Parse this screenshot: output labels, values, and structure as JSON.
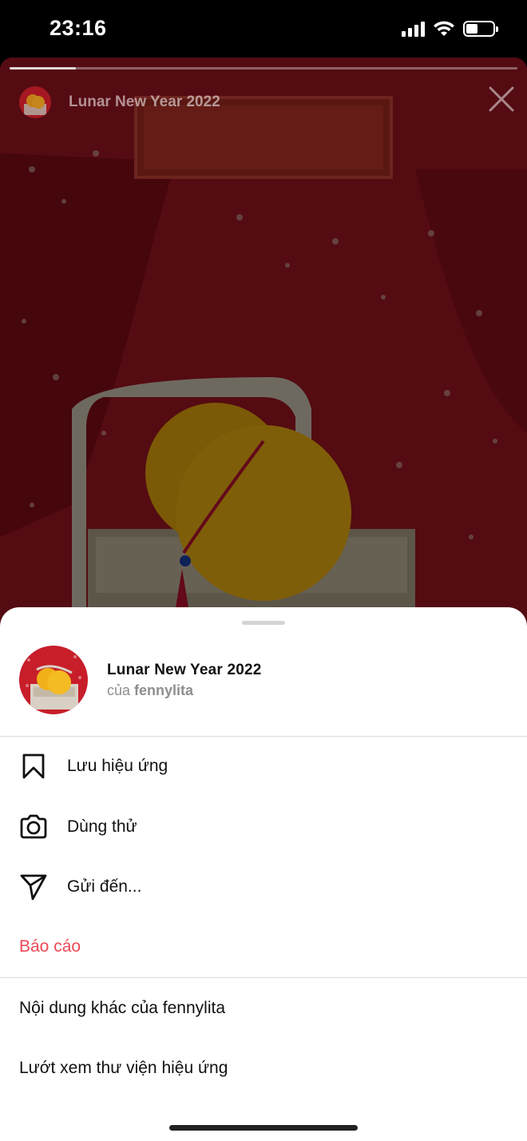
{
  "status_bar": {
    "time": "23:16",
    "battery_level": 0.45
  },
  "story": {
    "title": "Lunar New Year 2022",
    "progress": 0.13,
    "close_icon": "close-icon"
  },
  "sheet": {
    "effect_name": "Lunar New Year 2022",
    "by_prefix": "của",
    "author": "fennylita",
    "actions": [
      {
        "label": "Lưu hiệu ứng",
        "icon": "bookmark-icon"
      },
      {
        "label": "Dùng thử",
        "icon": "camera-icon"
      },
      {
        "label": "Gửi đến...",
        "icon": "send-icon"
      }
    ],
    "report_label": "Báo cáo",
    "more_links": [
      {
        "label": "Nội dung khác của fennylita"
      },
      {
        "label": "Lướt xem thư viện hiệu ứng"
      }
    ]
  },
  "colors": {
    "report": "#ed4956",
    "story_bg": "#7a0a14"
  }
}
